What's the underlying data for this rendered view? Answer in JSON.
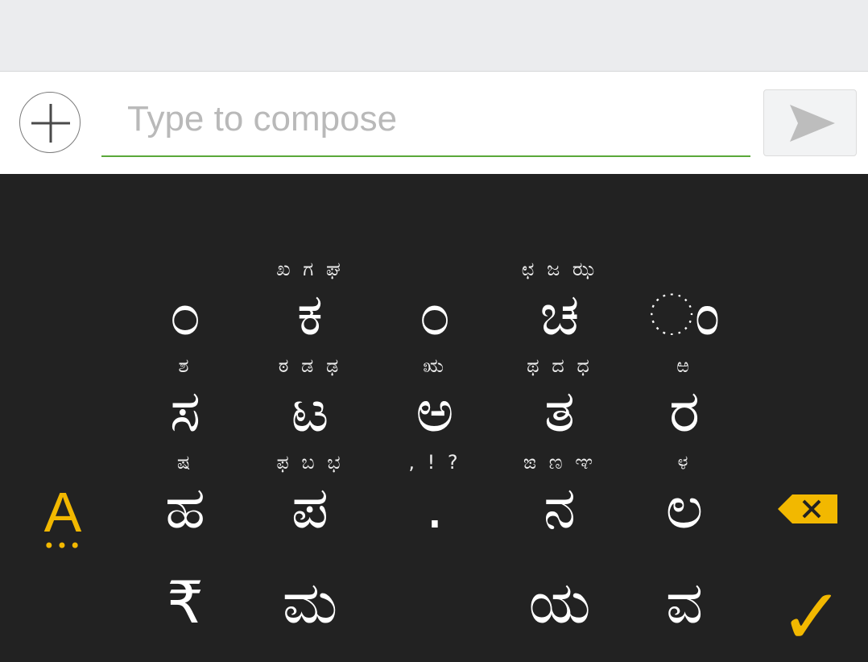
{
  "compose": {
    "placeholder": "Type to compose",
    "value": "",
    "underline_color": "#5aa83a"
  },
  "icons": {
    "add": "plus-circle-icon",
    "send": "send-arrow-icon",
    "backspace": "backspace-x-icon",
    "enter": "checkmark-icon",
    "language": "language-switch-icon"
  },
  "keyboard": {
    "accent_color": "#f2b800",
    "language_key_label": "A",
    "language_key_dots": "•••",
    "enter_label": "✓",
    "rows": [
      [
        {
          "main": "೦",
          "sub": ""
        },
        {
          "main": "ಕ",
          "sub": "ಖ ಗ ಘ"
        },
        {
          "main": "೦",
          "sub": ""
        },
        {
          "main": "ಚ",
          "sub": "ಛ ಜ ಝ"
        },
        {
          "main": "◌ಂ",
          "sub": ""
        }
      ],
      [
        {
          "main": "ಸ",
          "sub": "ಶ"
        },
        {
          "main": "ಟ",
          "sub": "ಠ ಡ ಢ"
        },
        {
          "main": "ಅ",
          "sub": "ಋ"
        },
        {
          "main": "ತ",
          "sub": "ಥ ದ ಧ"
        },
        {
          "main": "ರ",
          "sub": "ಱ"
        }
      ],
      [
        {
          "main": "ಹ",
          "sub": "ಷ"
        },
        {
          "main": "ಪ",
          "sub": "ಫ ಬ ಭ"
        },
        {
          "main": ".",
          "sub": ", ! ?"
        },
        {
          "main": "ನ",
          "sub": "ಙ ಣ ಞ"
        },
        {
          "main": "ಲ",
          "sub": "ಳ"
        }
      ],
      [
        {
          "main": "₹",
          "sub": ""
        },
        {
          "main": "ಮ",
          "sub": ""
        },
        {
          "main": "",
          "sub": ""
        },
        {
          "main": "ಯ",
          "sub": ""
        },
        {
          "main": "ವ",
          "sub": ""
        }
      ]
    ]
  }
}
